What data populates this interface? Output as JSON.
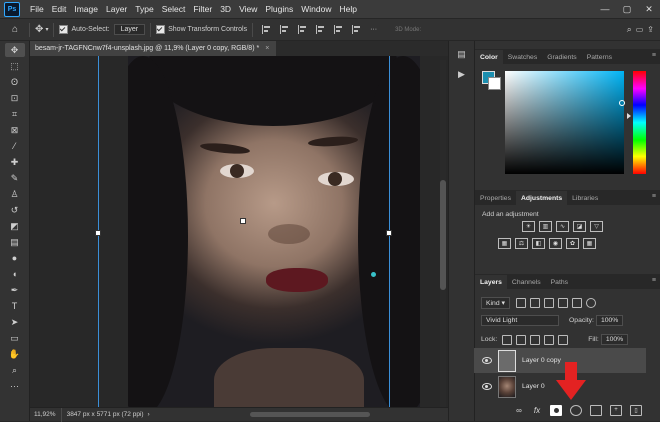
{
  "app": {
    "logo": "Ps"
  },
  "menu": [
    "File",
    "Edit",
    "Image",
    "Layer",
    "Type",
    "Select",
    "Filter",
    "3D",
    "View",
    "Plugins",
    "Window",
    "Help"
  ],
  "window_controls": {
    "minimize": "—",
    "maximize": "▢",
    "close": "✕"
  },
  "options_bar": {
    "auto_select_label": "Auto-Select:",
    "auto_select_value": "Layer",
    "show_transform_label": "Show Transform Controls",
    "mode_3d_label": "3D Mode:"
  },
  "document": {
    "tab_title": "besam-jr-TAGFNCnw7f4-unsplash.jpg @ 11,9% (Layer 0 copy, RGB/8) *",
    "close_glyph": "×",
    "zoom": "11,92%",
    "size_info": "3847 px x 5771 px (72 ppi)"
  },
  "color_panel": {
    "tabs": [
      "Color",
      "Swatches",
      "Gradients",
      "Patterns"
    ],
    "active_tab": "Color",
    "foreground": "#1c8fb0",
    "background": "#ffffff"
  },
  "adjustments_panel": {
    "tabs": [
      "Properties",
      "Adjustments",
      "Libraries"
    ],
    "active_tab": "Adjustments",
    "add_label": "Add an adjustment",
    "icons_row1": [
      "brightness-icon",
      "levels-icon",
      "curves-icon",
      "exposure-icon",
      "vibrance-icon"
    ],
    "icons_row2": [
      "hue-sat-icon",
      "color-balance-icon",
      "bw-icon",
      "photo-filter-icon",
      "channel-mixer-icon",
      "color-lookup-icon"
    ]
  },
  "layers_panel": {
    "tabs": [
      "Layers",
      "Channels",
      "Paths"
    ],
    "active_tab": "Layers",
    "kind_label": "Kind",
    "blend_mode": "Vivid Light",
    "opacity_label": "Opacity:",
    "opacity_value": "100%",
    "lock_label": "Lock:",
    "fill_label": "Fill:",
    "fill_value": "100%",
    "layers": [
      {
        "name": "Layer 0 copy",
        "selected": true
      },
      {
        "name": "Layer 0",
        "selected": false
      }
    ],
    "bottom_icons": [
      "link-icon",
      "fx-icon",
      "add-mask-icon",
      "adjustment-layer-icon",
      "group-icon",
      "new-layer-icon",
      "trash-icon"
    ]
  },
  "annotation": {
    "arrow_color": "#e32222"
  }
}
